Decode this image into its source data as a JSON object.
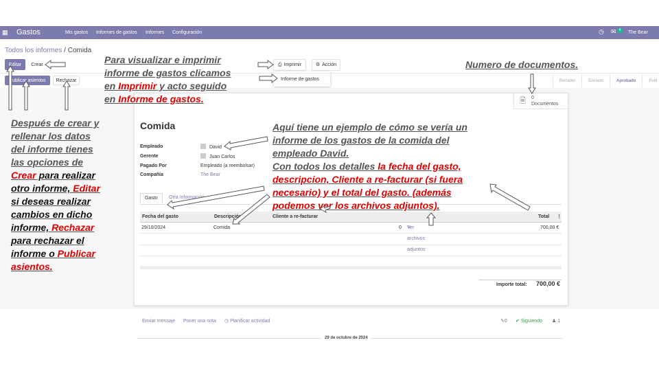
{
  "navbar": {
    "app_name": "Gastos",
    "menu": [
      "Mis gastos",
      "Informes de gastos",
      "Informes",
      "Configuración"
    ],
    "notif_count": "4",
    "user": "The Bear"
  },
  "breadcrumb": {
    "parent": "Todos los informes",
    "separator": " / ",
    "current": "Comida"
  },
  "actions": {
    "edit": "Editar",
    "create": "Crear",
    "print": "Imprimir",
    "action": "Acción",
    "print_option": "Informe de gastos",
    "publish": "Publicar asientos",
    "reject": "Rechazar"
  },
  "statusbar": [
    "Borrador",
    "Enviado",
    "Aprobado",
    "Publ"
  ],
  "docs": {
    "count": "0",
    "label": "Documentos"
  },
  "record": {
    "title": "Comida",
    "fields": [
      {
        "label": "Empleado",
        "value": "David"
      },
      {
        "label": "Gerente",
        "value": "Juan Carlos"
      },
      {
        "label": "Pagado Por",
        "value": "Empleado (a reembolsar)"
      },
      {
        "label": "Compañía",
        "value": "The Bear"
      }
    ]
  },
  "tabs": [
    "Gasto",
    "Otra Información"
  ],
  "table": {
    "headers": [
      "Fecha del gasto",
      "Descripción",
      "Cliente a re-facturar",
      "Total"
    ],
    "rows": [
      {
        "date": "29/10/2024",
        "description": "Comida",
        "qty": "0",
        "attachments": "Ver archivos adjuntos",
        "total": "700,00 €"
      }
    ]
  },
  "totals": {
    "label": "Importe total:",
    "value": "700,00 €"
  },
  "chatter": {
    "send": "Enviar mensaje",
    "note": "Poner una nota",
    "activity": "Planificar actividad",
    "attachments": "0",
    "following": "Siguiendo",
    "followers": "1",
    "date": "29 de octubre de 2024"
  },
  "annotations": {
    "print_note": {
      "t1": "Para visualizar e imprimir",
      "t2": "informe de gastos clicamos",
      "t3a": "en ",
      "t3b": "Imprimir",
      "t3c": " y acto seguido",
      "t4a": "en ",
      "t4b": "Informe de gastos."
    },
    "docs_note": "Numero de documentos.",
    "left_note": {
      "l1": "Después de crear y",
      "l2": "rellenar los datos",
      "l3": "del informe tienes",
      "l4": "las opciones de",
      "l5a": "Crear",
      "l5b": " para realizar",
      "l6a": "otro informe, ",
      "l6b": "Editar",
      "l7": "si deseas realizar",
      "l8": "cambios en dicho",
      "l9a": "informe, ",
      "l9b": "Rechazar",
      "l10": "para rechazar  el",
      "l11a": "informe o ",
      "l11b": "Publicar",
      "l12": "asientos."
    },
    "center_note": {
      "l1": "Aquí tiene un ejemplo de cómo se vería un",
      "l2": "informe de los gastos de la comida del",
      "l3": "empleado  David.",
      "l4a": "Con todos los detalles ",
      "l4b": "la fecha del gasto,",
      "l5": "descripcion,  Cliente a re-facturar (si fuera",
      "l6": "necesario) y el total del gasto. (además",
      "l7": "podemos  ver los archivos adjuntos)."
    }
  },
  "colors": {
    "brand": "#7c7bad",
    "annotation_red": "#e00000",
    "annotation_grey": "#555555"
  }
}
